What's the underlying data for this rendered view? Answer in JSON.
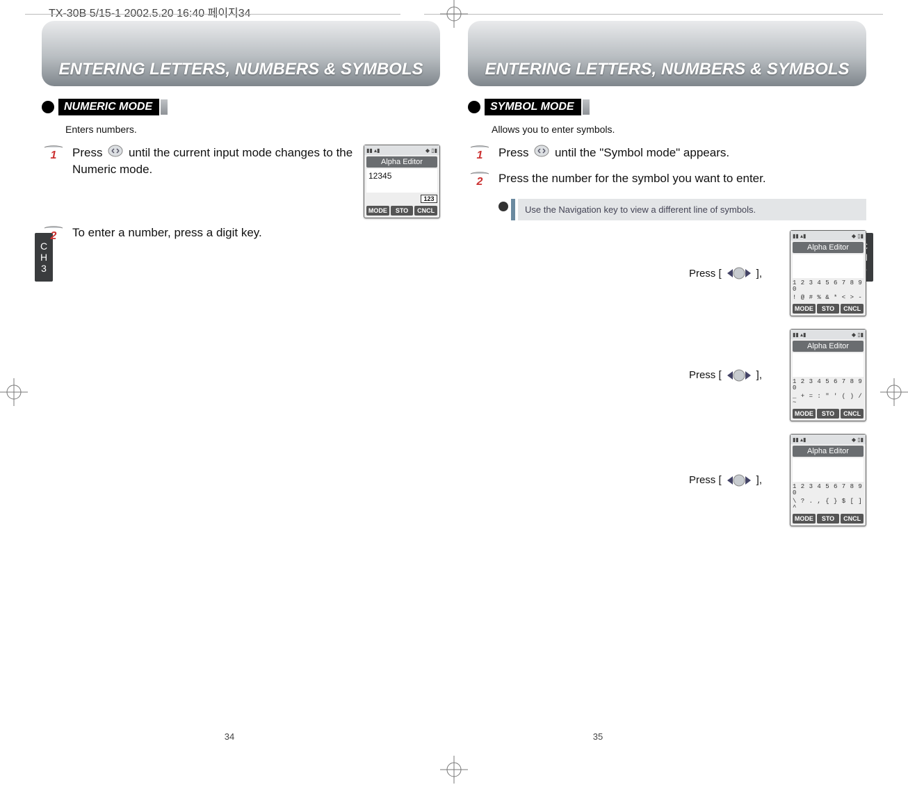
{
  "header": {
    "path": "TX-30B 5/15-1  2002.5.20 16:40  페이지34"
  },
  "chtab": {
    "line1": "C",
    "line2": "H",
    "line3": "3"
  },
  "left": {
    "banner": "ENTERING LETTERS, NUMBERS & SYMBOLS",
    "section": "NUMERIC MODE",
    "subtext": "Enters numbers.",
    "step1": "Press        until the current input mode changes to the Numeric mode.",
    "step1_pre": "Press",
    "step1_post": "until the current input mode changes to the Numeric mode.",
    "step2": "To enter a number, press a digit key.",
    "screen": {
      "title": "Alpha Editor",
      "body": "12345",
      "badge": "123",
      "softkeys": [
        "MODE",
        "STO",
        "CNCL"
      ]
    },
    "pagenum": "34"
  },
  "right": {
    "banner": "ENTERING LETTERS, NUMBERS & SYMBOLS",
    "section": "SYMBOL MODE",
    "subtext": "Allows you to enter symbols.",
    "step1_pre": "Press",
    "step1_post": "until the \"Symbol mode\" appears.",
    "step2": "Press the number for the symbol you want to enter.",
    "note": "Use the Navigation key to view a different line of symbols.",
    "press_label": "Press [",
    "press_label_end": "],",
    "screens": [
      {
        "title": "Alpha Editor",
        "nums": "1 2 3 4 5 6 7 8 9 0",
        "syms": "! @ # % & * < > -",
        "softkeys": [
          "MODE",
          "STO",
          "CNCL"
        ]
      },
      {
        "title": "Alpha Editor",
        "nums": "1 2 3 4 5 6 7 8 9 0",
        "syms": "_ + = : \" ' ( ) / ~",
        "softkeys": [
          "MODE",
          "STO",
          "CNCL"
        ]
      },
      {
        "title": "Alpha Editor",
        "nums": "1 2 3 4 5 6 7 8 9 0",
        "syms": "\\ ? . , { } $ [ ] ^",
        "softkeys": [
          "MODE",
          "STO",
          "CNCL"
        ]
      }
    ],
    "pagenum": "35"
  }
}
